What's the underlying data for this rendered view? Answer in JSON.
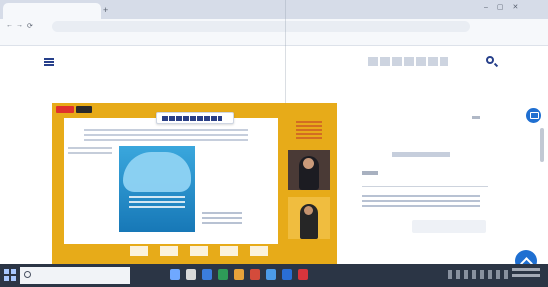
{
  "browser": {
    "tab_title": "",
    "url": "",
    "bookmarks": [
      "",
      "",
      "",
      "",
      "",
      "",
      "",
      ""
    ]
  },
  "page": {
    "site_title": "",
    "breadcrumb": "",
    "search_prompt": "",
    "panel_title": "",
    "field_label": "",
    "field_value": "",
    "panel_text": "",
    "panel_button": ""
  },
  "video": {
    "rec_badge": "",
    "live_badge": "",
    "chip_text": "",
    "slide_heading": "",
    "slide_side": "",
    "cover_text": "",
    "slide_note": ""
  },
  "taskbar": {
    "search_placeholder": "",
    "clock": ""
  },
  "colors": {
    "accent": "#1f6fd1",
    "brand": "#27408b",
    "video_frame": "#e7ab19",
    "taskbar": "#2b3545",
    "record": "#e0312c"
  },
  "icons": [
    "menu-icon",
    "search-icon",
    "chat-icon",
    "scroll-up-icon",
    "windows-start-icon",
    "taskbar-search-icon"
  ]
}
